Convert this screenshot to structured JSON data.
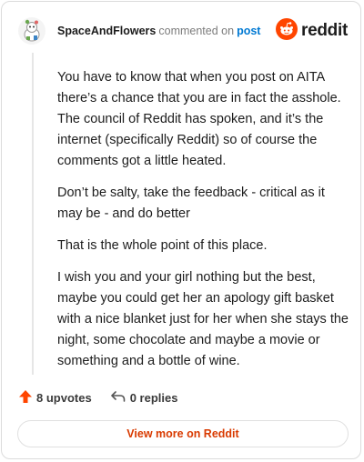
{
  "header": {
    "username": "SpaceAndFlowers",
    "action": "commented on",
    "post_link": "post",
    "brand": "reddit",
    "avatar_icon": "snoo-avatar-icon",
    "brand_icon": "reddit-logo-icon"
  },
  "comment": {
    "paragraphs": [
      "You have to know that when you post on AITA there’s a chance that you are in fact the asshole. The council of Reddit has spoken, and it’s the internet (specifically Reddit) so of course the comments got a little heated.",
      "Don’t be salty, take the feedback - critical as it may be - and do better",
      "That is the whole point of this place.",
      "I wish you and your girl nothing but the best, maybe you could get her an apology gift basket with a nice blanket just for her when she stays the night, some chocolate and maybe a movie or something and a bottle of wine."
    ]
  },
  "footer": {
    "upvotes": "8 upvotes",
    "replies": "0 replies",
    "upvote_icon": "upvote-arrow-icon",
    "reply_icon": "reply-arrow-icon"
  },
  "cta": {
    "label": "View more on Reddit"
  },
  "colors": {
    "brand": "#ff4500",
    "link": "#0079d3",
    "cta_text": "#d93a00"
  }
}
